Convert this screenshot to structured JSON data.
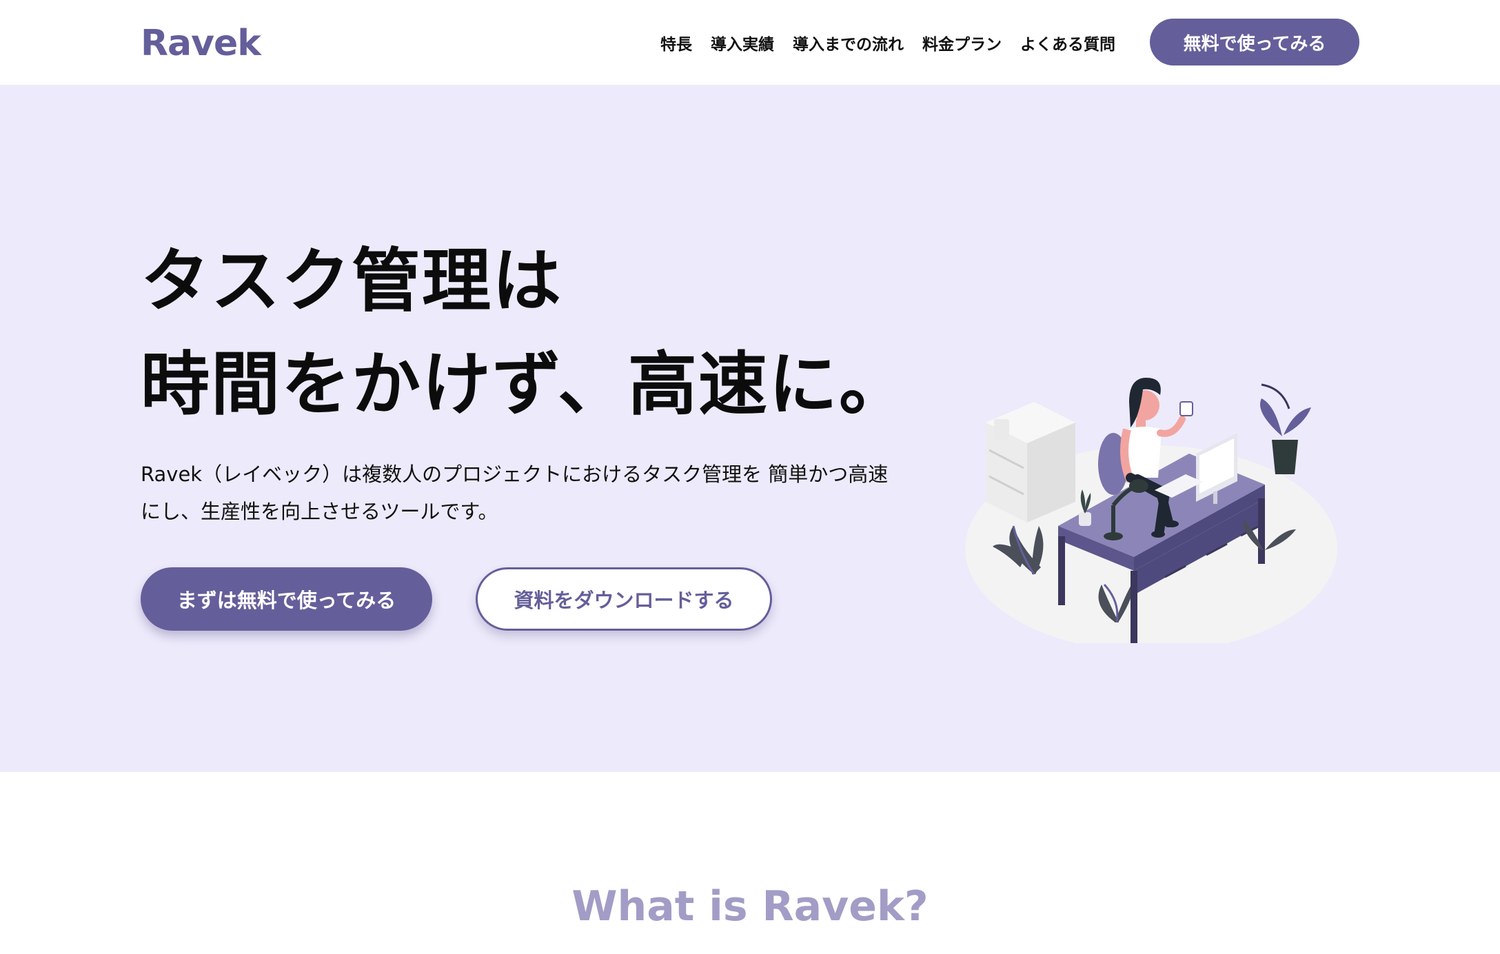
{
  "header": {
    "logo": "Ravek",
    "nav": [
      "特長",
      "導入実績",
      "導入までの流れ",
      "料金プラン",
      "よくある質問"
    ],
    "cta_label": "無料で使ってみる"
  },
  "hero": {
    "title_lines": [
      "タスク管理は",
      "時間をかけず、高速に。"
    ],
    "description_lines": [
      "Ravek（レイベック）は複数人のプロジェクトにおけるタスク管理を 簡単かつ高速",
      "にし、生産性を向上させるツールです。"
    ],
    "primary_button": "まずは無料で使ってみる",
    "secondary_button": "資料をダウンロードする",
    "illustration": "woman-at-desk-illustration"
  },
  "about": {
    "title": "What is Ravek?"
  },
  "colors": {
    "brand": "#645f9a",
    "hero_background": "#edeafb",
    "about_title": "#a29dc6"
  }
}
